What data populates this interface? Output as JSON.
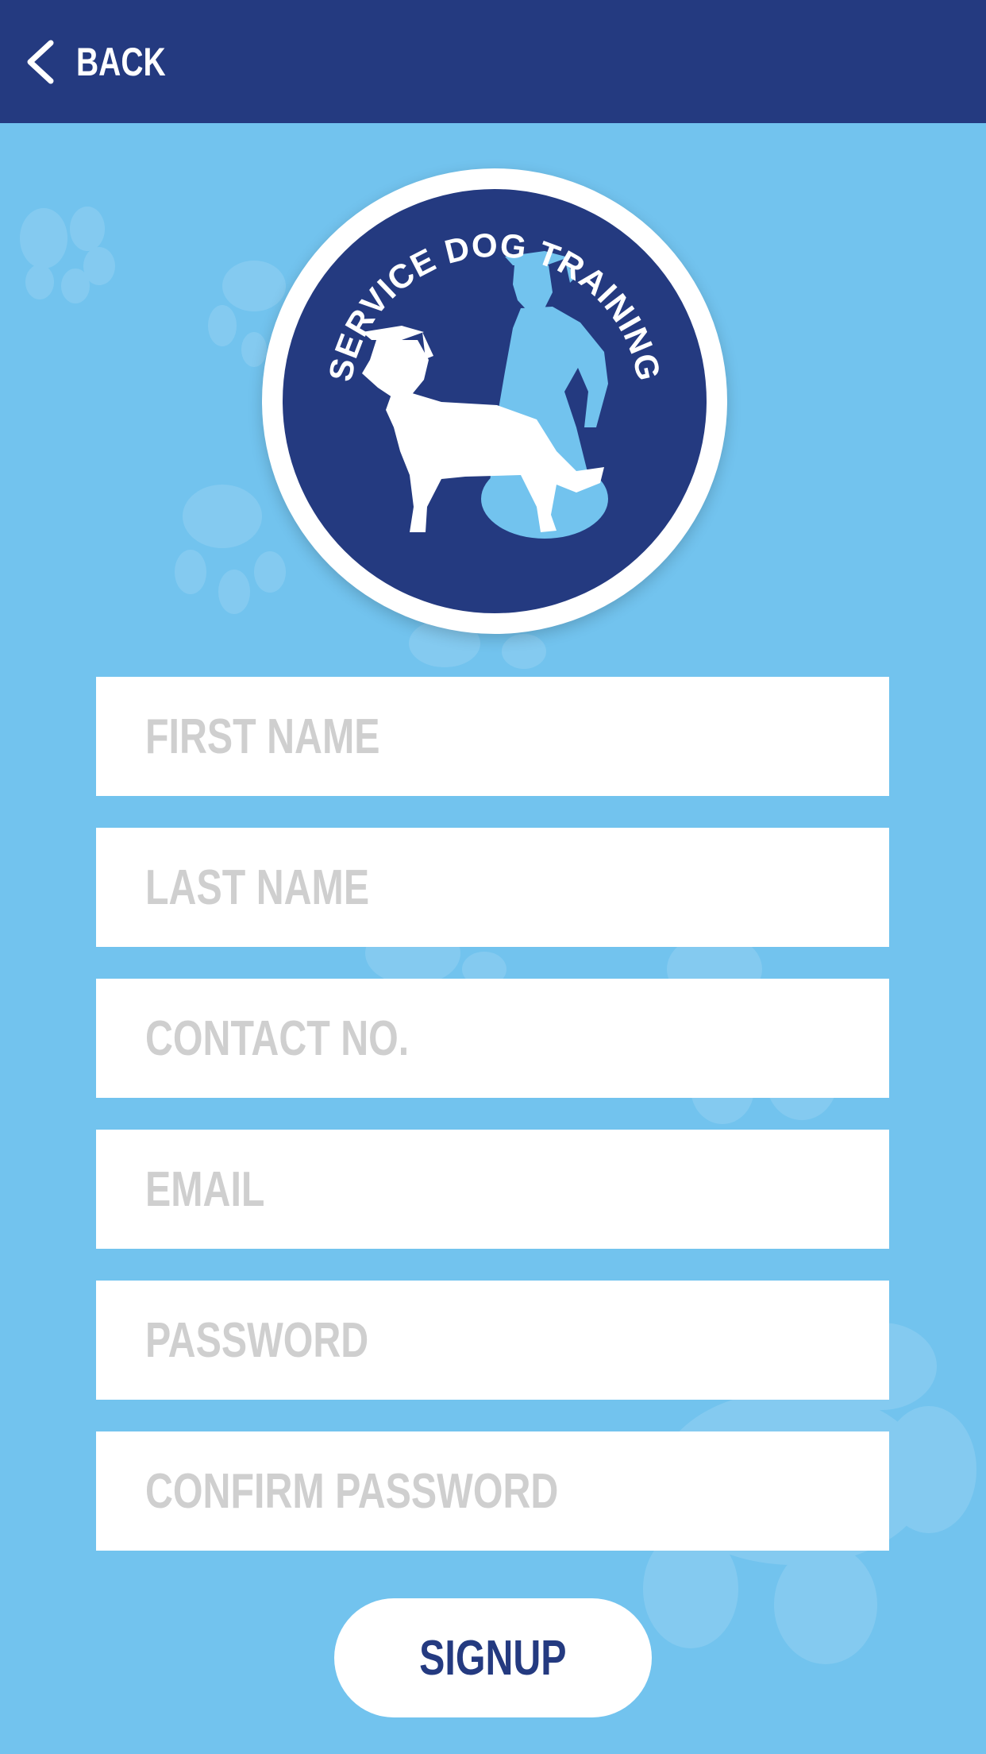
{
  "header": {
    "back_label": "BACK",
    "back_icon": "chevron-left-icon"
  },
  "logo": {
    "text": "SERVICE DOG TRAINING"
  },
  "form": {
    "fields": [
      {
        "placeholder": "FIRST NAME",
        "value": ""
      },
      {
        "placeholder": "LAST NAME",
        "value": ""
      },
      {
        "placeholder": "CONTACT NO.",
        "value": ""
      },
      {
        "placeholder": "EMAIL",
        "value": ""
      },
      {
        "placeholder": "PASSWORD",
        "value": ""
      },
      {
        "placeholder": "CONFIRM PASSWORD",
        "value": ""
      }
    ],
    "submit_label": "SIGNUP"
  },
  "colors": {
    "background": "#72c3ee",
    "header": "#243a80",
    "accent": "#243a80",
    "field": "#ffffff",
    "placeholder": "#cfcfcf"
  }
}
